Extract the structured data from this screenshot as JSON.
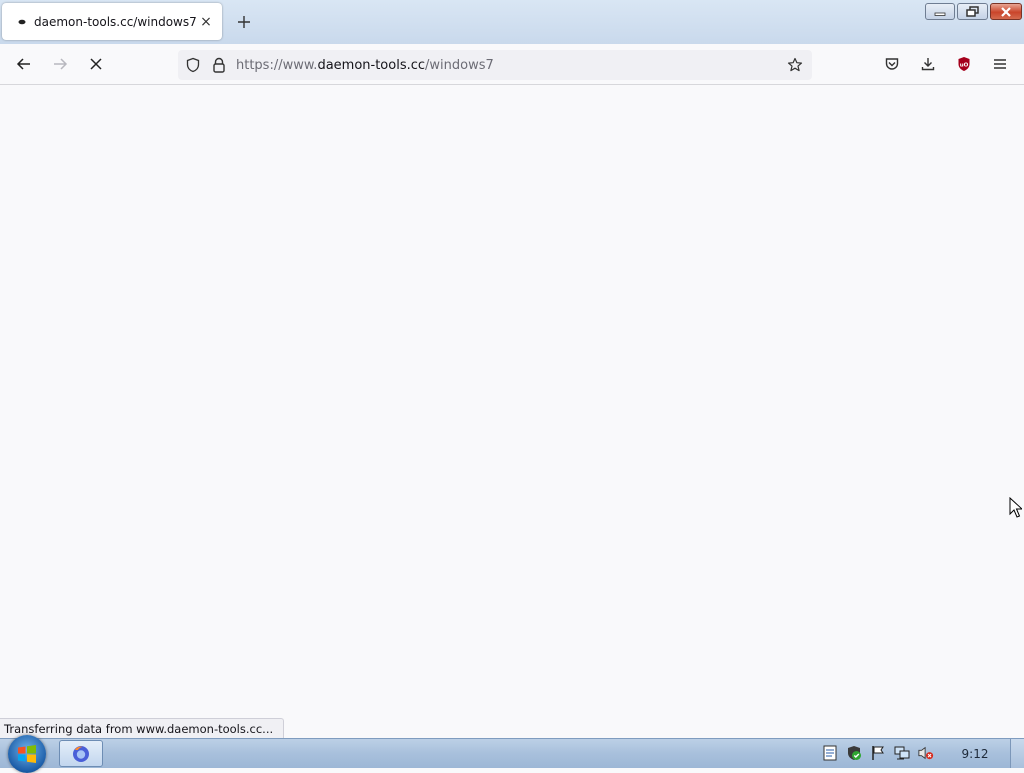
{
  "tab": {
    "title": "daemon-tools.cc/windows7",
    "close_glyph": "×",
    "favicon": "loading-dot-icon"
  },
  "new_tab_glyph": "+",
  "window_controls": [
    "minimize-icon",
    "maximize-icon",
    "close-icon"
  ],
  "toolbar": {
    "back_icon": "back-arrow-icon",
    "forward_icon": "forward-arrow-icon",
    "stop_icon": "stop-icon",
    "right_icons": [
      "pocket-icon",
      "downloads-icon",
      "ublock-icon",
      "menu-icon"
    ]
  },
  "url": {
    "prefix": "https://www.",
    "host": "daemon-tools.cc",
    "path": "/windows7"
  },
  "status_text": "Transferring data from www.daemon-tools.cc...",
  "taskbar": {
    "clock": "9:12",
    "tray_icons": [
      "notes-icon",
      "security-shield-icon",
      "action-center-flag-icon",
      "network-icon",
      "volume-muted-icon"
    ]
  },
  "colors": {
    "page_background": "#f9f9fb",
    "urlbar_background": "#f0f0f4",
    "ublock_red": "#a5001c",
    "close_button_red": "#c9452b"
  }
}
